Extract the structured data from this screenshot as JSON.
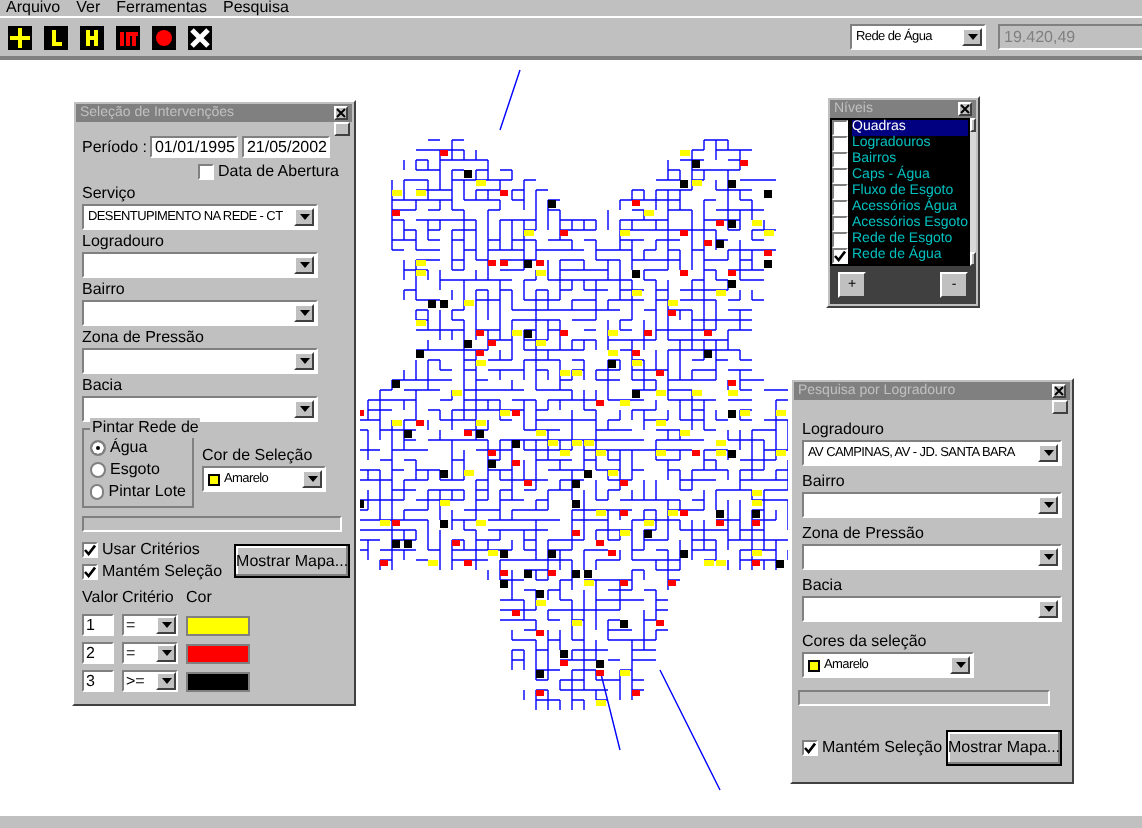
{
  "menu": [
    {
      "label": "Arquivo"
    },
    {
      "label": "Ver"
    },
    {
      "label": "Ferramentas"
    },
    {
      "label": "Pesquisa"
    }
  ],
  "toolbar": {
    "tools": [
      {
        "kind": "move"
      },
      {
        "kind": "line"
      },
      {
        "kind": "bar"
      },
      {
        "kind": "mt"
      },
      {
        "kind": "record"
      },
      {
        "kind": "cross"
      }
    ],
    "layer_select": "Rede de Água",
    "coordinate": "19.420,49"
  },
  "selection_panel": {
    "title": "Seleção de Intervenções",
    "period_label": "Período :",
    "date_from": "01/01/1995",
    "date_to": "21/05/2002",
    "opening_date": {
      "label": "Data de Abertura",
      "checked": false
    },
    "fields": [
      {
        "label": "Serviço",
        "value": "DESENTUPIMENTO NA REDE - CT"
      },
      {
        "label": "Logradouro"
      },
      {
        "label": "Bairro"
      },
      {
        "label": "Zona de Pressão"
      },
      {
        "label": "Bacia"
      }
    ],
    "paint_group": {
      "title": "Pintar Rede de",
      "options": [
        {
          "label": "Água",
          "selected": true
        },
        {
          "label": "Esgoto",
          "selected": false
        },
        {
          "label": "Pintar Lote",
          "selected": false
        }
      ]
    },
    "color_label": "Cor de Seleção",
    "color_choice": {
      "label": "Amarelo",
      "color": "#ffff00"
    },
    "progress": {
      "level": 0
    },
    "checks": [
      {
        "label": "Usar Critérios",
        "checked": true
      },
      {
        "label": "Mantém Seleção",
        "checked": true
      }
    ],
    "button": "Mostrar Mapa...",
    "criteria_headers": [
      "Valor",
      "Critério",
      "Cor"
    ],
    "criteria": [
      {
        "value": "1",
        "operator": "=",
        "color": "#ffff00"
      },
      {
        "value": "2",
        "operator": "=",
        "color": "#ff0000"
      },
      {
        "value": "3",
        "operator": ">=",
        "color": "#000000"
      }
    ]
  },
  "layers_panel": {
    "title": "Níveis",
    "items": [
      {
        "label": "Quadras",
        "checked": false,
        "selected": true
      },
      {
        "label": "Logradouros",
        "checked": false,
        "selected": false
      },
      {
        "label": "Bairros",
        "checked": false,
        "selected": false
      },
      {
        "label": "Caps - Água",
        "checked": false,
        "selected": false
      },
      {
        "label": "Fluxo de Esgoto",
        "checked": false,
        "selected": false
      },
      {
        "label": "Acessórios Água",
        "checked": false,
        "selected": false
      },
      {
        "label": "Acessórios Esgoto",
        "checked": false,
        "selected": false
      },
      {
        "label": "Rede de Esgoto",
        "checked": false,
        "selected": false
      },
      {
        "label": "Rede de Água",
        "checked": true,
        "selected": false
      }
    ],
    "buttons": [
      "+",
      "-"
    ]
  },
  "search_panel": {
    "title": "Pesquisa por Logradouro",
    "fields": [
      {
        "label": "Logradouro",
        "value": "AV  CAMPINAS, AV - JD. SANTA BARA"
      },
      {
        "label": "Bairro"
      },
      {
        "label": "Zona de Pressão"
      },
      {
        "label": "Bacia"
      }
    ],
    "color_label": "Cores da seleção",
    "color_choice": {
      "label": "Amarelo",
      "color": "#ffff00"
    },
    "progress": {
      "level": 0
    },
    "check": {
      "label": "Mantém Seleção",
      "checked": true
    },
    "button": "Mostrar Mapa..."
  }
}
